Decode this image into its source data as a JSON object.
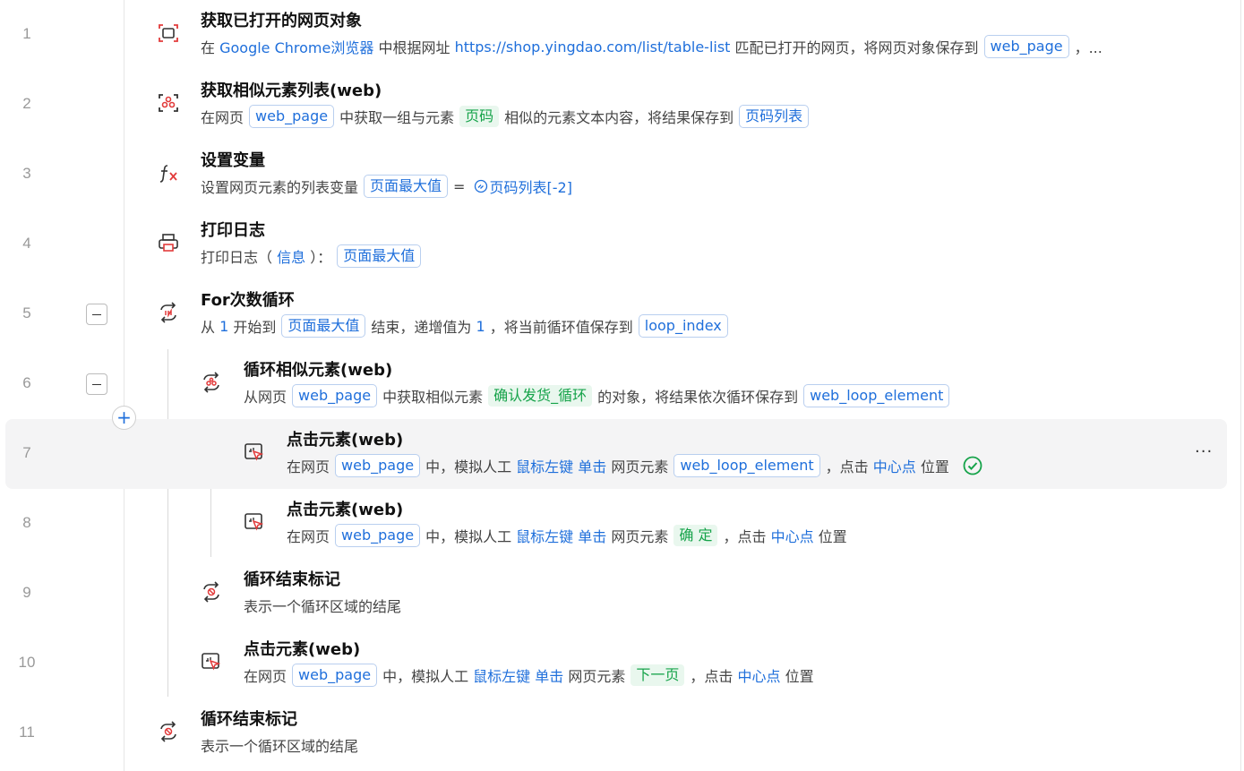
{
  "steps": [
    {
      "line": "1",
      "title": "获取已打开的网页对象",
      "d": [
        "在 ",
        "Google Chrome浏览器",
        " 中根据网址 ",
        "https://shop.yingdao.com/list/table-list",
        " 匹配已打开的网页，将网页对象保存到",
        "web_page",
        "，..."
      ]
    },
    {
      "line": "2",
      "title": "获取相似元素列表(web)",
      "d": [
        "在网页",
        "web_page",
        "中获取一组与元素",
        "页码",
        "相似的元素文本内容，将结果保存到",
        "页码列表"
      ]
    },
    {
      "line": "3",
      "title": "设置变量",
      "d": [
        "设置网页元素的列表变量",
        "页面最大值",
        "= ",
        "页码列表[-2]"
      ]
    },
    {
      "line": "4",
      "title": "打印日志",
      "d": [
        "打印日志（ ",
        "信息",
        " ）：",
        "页面最大值"
      ]
    },
    {
      "line": "5",
      "title": "For次数循环",
      "d": [
        "从 ",
        "1",
        " 开始到",
        "页面最大值",
        "结束，递增值为 ",
        "1",
        " ，将当前循环值保存到",
        "loop_index"
      ]
    },
    {
      "line": "6",
      "title": "循环相似元素(web)",
      "d": [
        "从网页",
        "web_page",
        "中获取相似元素",
        "确认发货_循环",
        "的对象，将结果依次循环保存到",
        "web_loop_element"
      ]
    },
    {
      "line": "7",
      "title": "点击元素(web)",
      "d": [
        "在网页",
        "web_page",
        "中，模拟人工 ",
        "鼠标左键",
        " ",
        "单击",
        " 网页元素",
        "web_loop_element",
        "，点击 ",
        "中心点",
        " 位置"
      ]
    },
    {
      "line": "8",
      "title": "点击元素(web)",
      "d": [
        "在网页",
        "web_page",
        "中，模拟人工 ",
        "鼠标左键",
        " ",
        "单击",
        " 网页元素",
        "确 定",
        "，点击 ",
        "中心点",
        " 位置"
      ]
    },
    {
      "line": "9",
      "title": "循环结束标记",
      "d": [
        "表示一个循环区域的结尾"
      ]
    },
    {
      "line": "10",
      "title": "点击元素(web)",
      "d": [
        "在网页",
        "web_page",
        "中，模拟人工 ",
        "鼠标左键",
        " ",
        "单击",
        " 网页元素",
        "下一页",
        "，点击 ",
        "中心点",
        " 位置"
      ]
    },
    {
      "line": "11",
      "title": "循环结束标记",
      "d": [
        "表示一个循环区域的结尾"
      ]
    }
  ],
  "add_button_label": "+",
  "more_label": "···",
  "colors": {
    "accent": "#1f6fdb",
    "element": "#16a34a",
    "icon": "#e23b3b"
  }
}
